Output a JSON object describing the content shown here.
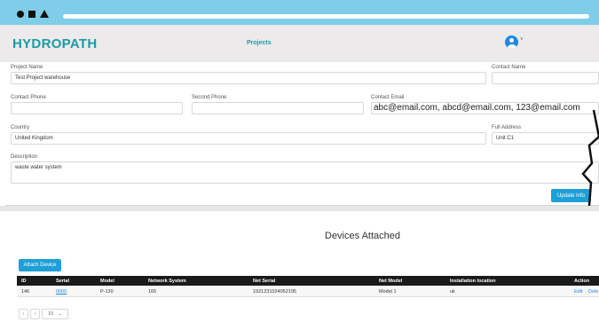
{
  "app": {
    "logo": "HYDROPATH",
    "nav_projects": "Projects",
    "avatar_caret": "˅"
  },
  "form": {
    "project_name": {
      "label": "Project Name",
      "value": "Test Project warehouse"
    },
    "contact_name": {
      "label": "Contact Name",
      "value": ""
    },
    "contact_phone": {
      "label": "Contact Phone",
      "value": ""
    },
    "second_phone": {
      "label": "Second Phone",
      "value": ""
    },
    "contact_email": {
      "label": "Contact Email",
      "value": "abc@email.com, abcd@email.com, 123@email.com"
    },
    "country": {
      "label": "Country",
      "value": "United Kingdom"
    },
    "full_address": {
      "label": "Full Address",
      "value": "Unit C1"
    },
    "description": {
      "label": "Description",
      "value": "waste water system"
    },
    "update_button": "Update Info"
  },
  "devices": {
    "title": "Devices Attached",
    "attach_button": "Attach Device",
    "columns": [
      "ID",
      "Serial",
      "Model",
      "Network System",
      "Net Serial",
      "Net Model",
      "Installation location",
      "Action"
    ],
    "rows": [
      {
        "id": "146",
        "serial": "0000",
        "model": "P-130",
        "network_system": "165",
        "net_serial": "1921231024052195",
        "net_model": "Model 1",
        "installation_location": "uk",
        "edit": "Edit",
        "delete": "Dele"
      }
    ]
  },
  "pager": {
    "prev": "‹",
    "next": "›",
    "page_size": "10",
    "caret": "⌄"
  },
  "colors": {
    "brand": "#1a9ba6",
    "accent": "#1e9fd8",
    "chrome": "#7fcde8",
    "header_bg": "#eceaeb"
  }
}
